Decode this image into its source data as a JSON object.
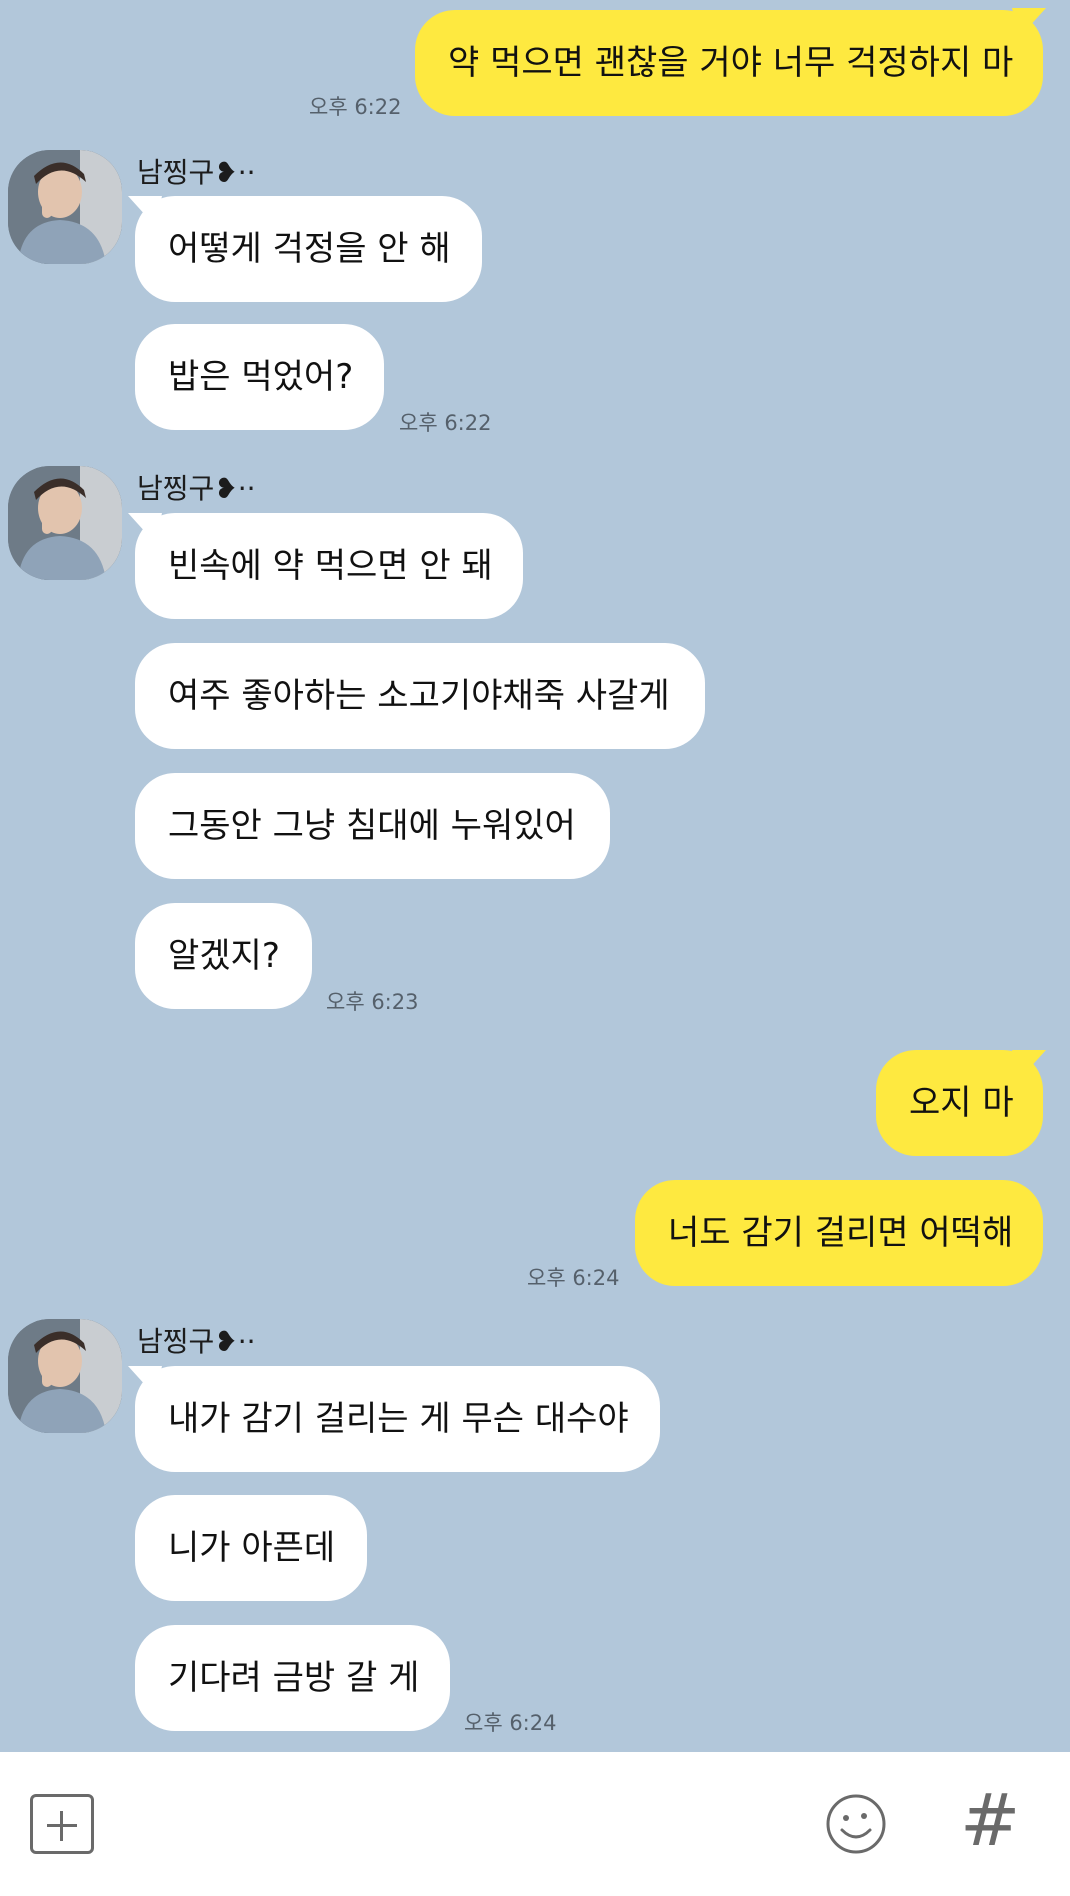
{
  "contact": {
    "name": "남찡구❥··"
  },
  "messages": [
    {
      "text": "약 먹으면 괜찮을 거야 너무 걱정하지 마",
      "time": "오후 6:22"
    },
    {
      "text": "어떻게 걱정을 안 해"
    },
    {
      "text": "밥은 먹었어?",
      "time": "오후 6:22"
    },
    {
      "text": "빈속에 약 먹으면 안 돼"
    },
    {
      "text": "여주 좋아하는 소고기야채죽 사갈게"
    },
    {
      "text": "그동안 그냥 침대에 누워있어"
    },
    {
      "text": "알겠지?",
      "time": "오후 6:23"
    },
    {
      "text": "오지 마"
    },
    {
      "text": "너도 감기 걸리면 어떡해",
      "time": "오후 6:24"
    },
    {
      "text": "내가 감기 걸리는 게 무슨 대수야"
    },
    {
      "text": "니가 아픈데"
    },
    {
      "text": "기다려 금방 갈 게",
      "time": "오후 6:24"
    }
  ],
  "input_bar": {
    "plus_icon": "plus-square-icon",
    "emoji_icon": "smiley-icon",
    "hash_label": "#"
  },
  "colors": {
    "background": "#b2c7da",
    "my_bubble": "#fee940",
    "their_bubble": "#ffffff"
  }
}
